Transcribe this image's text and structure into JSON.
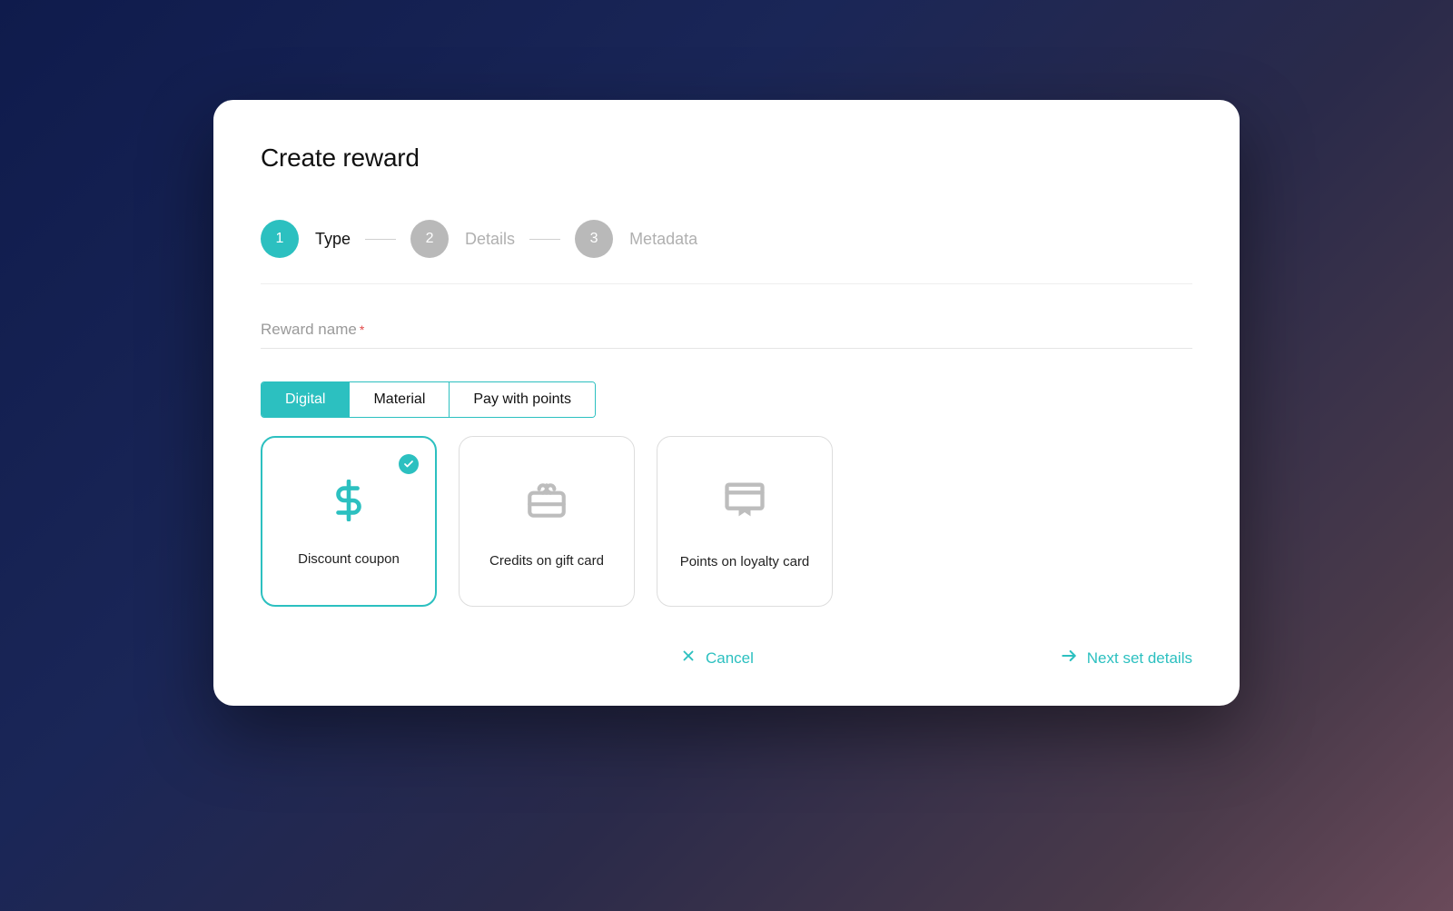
{
  "modal": {
    "title": "Create reward"
  },
  "stepper": {
    "steps": [
      {
        "number": "1",
        "label": "Type"
      },
      {
        "number": "2",
        "label": "Details"
      },
      {
        "number": "3",
        "label": "Metadata"
      }
    ]
  },
  "form": {
    "reward_name_label": "Reward name",
    "tabs": {
      "digital": "Digital",
      "material": "Material",
      "pay_with_points": "Pay with points"
    },
    "cards": {
      "discount_coupon": "Discount coupon",
      "credits_gift_card": "Credits on gift card",
      "points_loyalty_card": "Points on loyalty card"
    }
  },
  "actions": {
    "cancel": "Cancel",
    "next": "Next set details"
  }
}
